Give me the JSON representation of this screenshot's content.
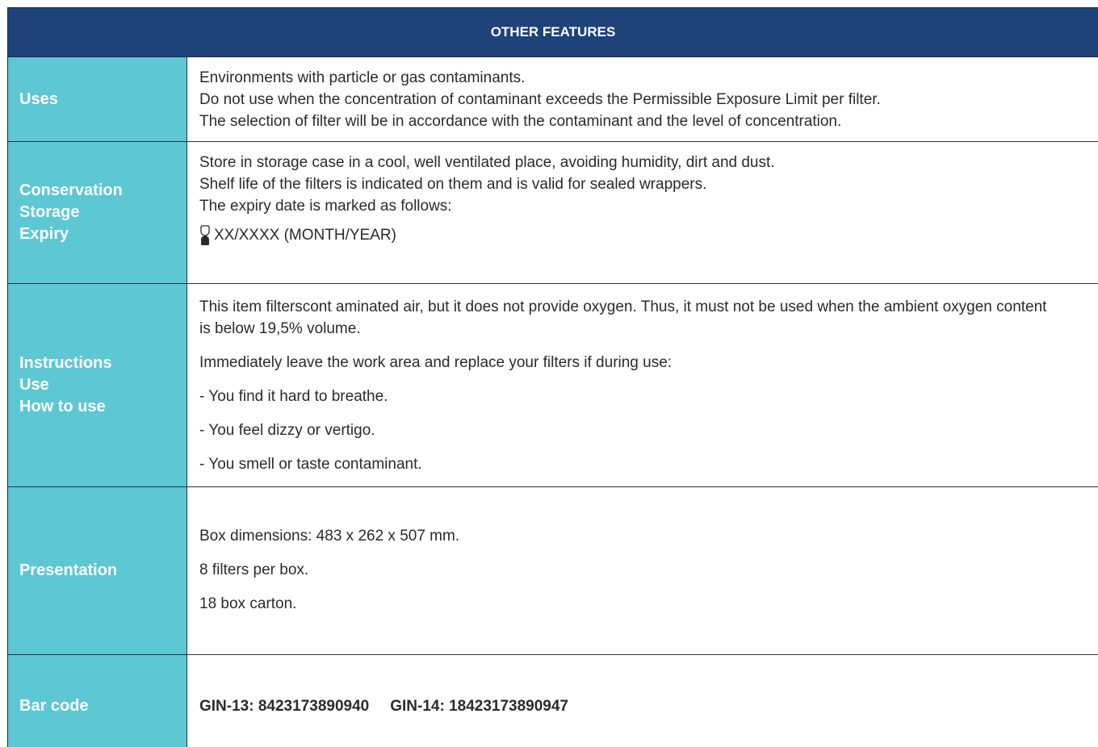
{
  "header": {
    "title": "OTHER FEATURES"
  },
  "rows": {
    "uses": {
      "label": "Uses",
      "lines": [
        "Environments with particle or gas contaminants.",
        "Do not use when the concentration of contaminant exceeds the Permissible Exposure Limit per filter.",
        "The selection of filter will be in accordance with the contaminant and the level of concentration."
      ]
    },
    "conservation": {
      "label_lines": [
        "Conservation",
        "Storage",
        "Expiry"
      ],
      "lines": [
        "Store in storage case in a cool, well ventilated place, avoiding humidity, dirt and dust.",
        "Shelf life of the filters is indicated on them and is valid for sealed wrappers.",
        "The expiry date is marked as follows:"
      ],
      "expiry_icon": "hourglass-icon",
      "expiry_text": "XX/XXXX (MONTH/YEAR)"
    },
    "instructions": {
      "label_lines": [
        "Instructions",
        "Use",
        "How to use"
      ],
      "lines": [
        "This item filterscont  aminated air, but it does not provide oxygen. Thus, it must not be used when the ambient oxygen content is below 19,5% volume.",
        "Immediately leave the work area and replace your filters if during use:",
        "- You find it hard to breathe.",
        "- You feel dizzy or vertigo.",
        "- You smell or taste contaminant."
      ]
    },
    "presentation": {
      "label": "Presentation",
      "lines": [
        "Box dimensions: 483 x 262 x 507 mm.",
        "8 filters per box.",
        "18 box carton."
      ]
    },
    "barcode": {
      "label": "Bar code",
      "gin13": "GIN-13: 8423173890940",
      "gin14": "GIN-14: 18423173890947"
    }
  },
  "colors": {
    "header_bg": "#1e4279",
    "label_bg": "#5dc7d3",
    "text": "#2b2b2b"
  }
}
